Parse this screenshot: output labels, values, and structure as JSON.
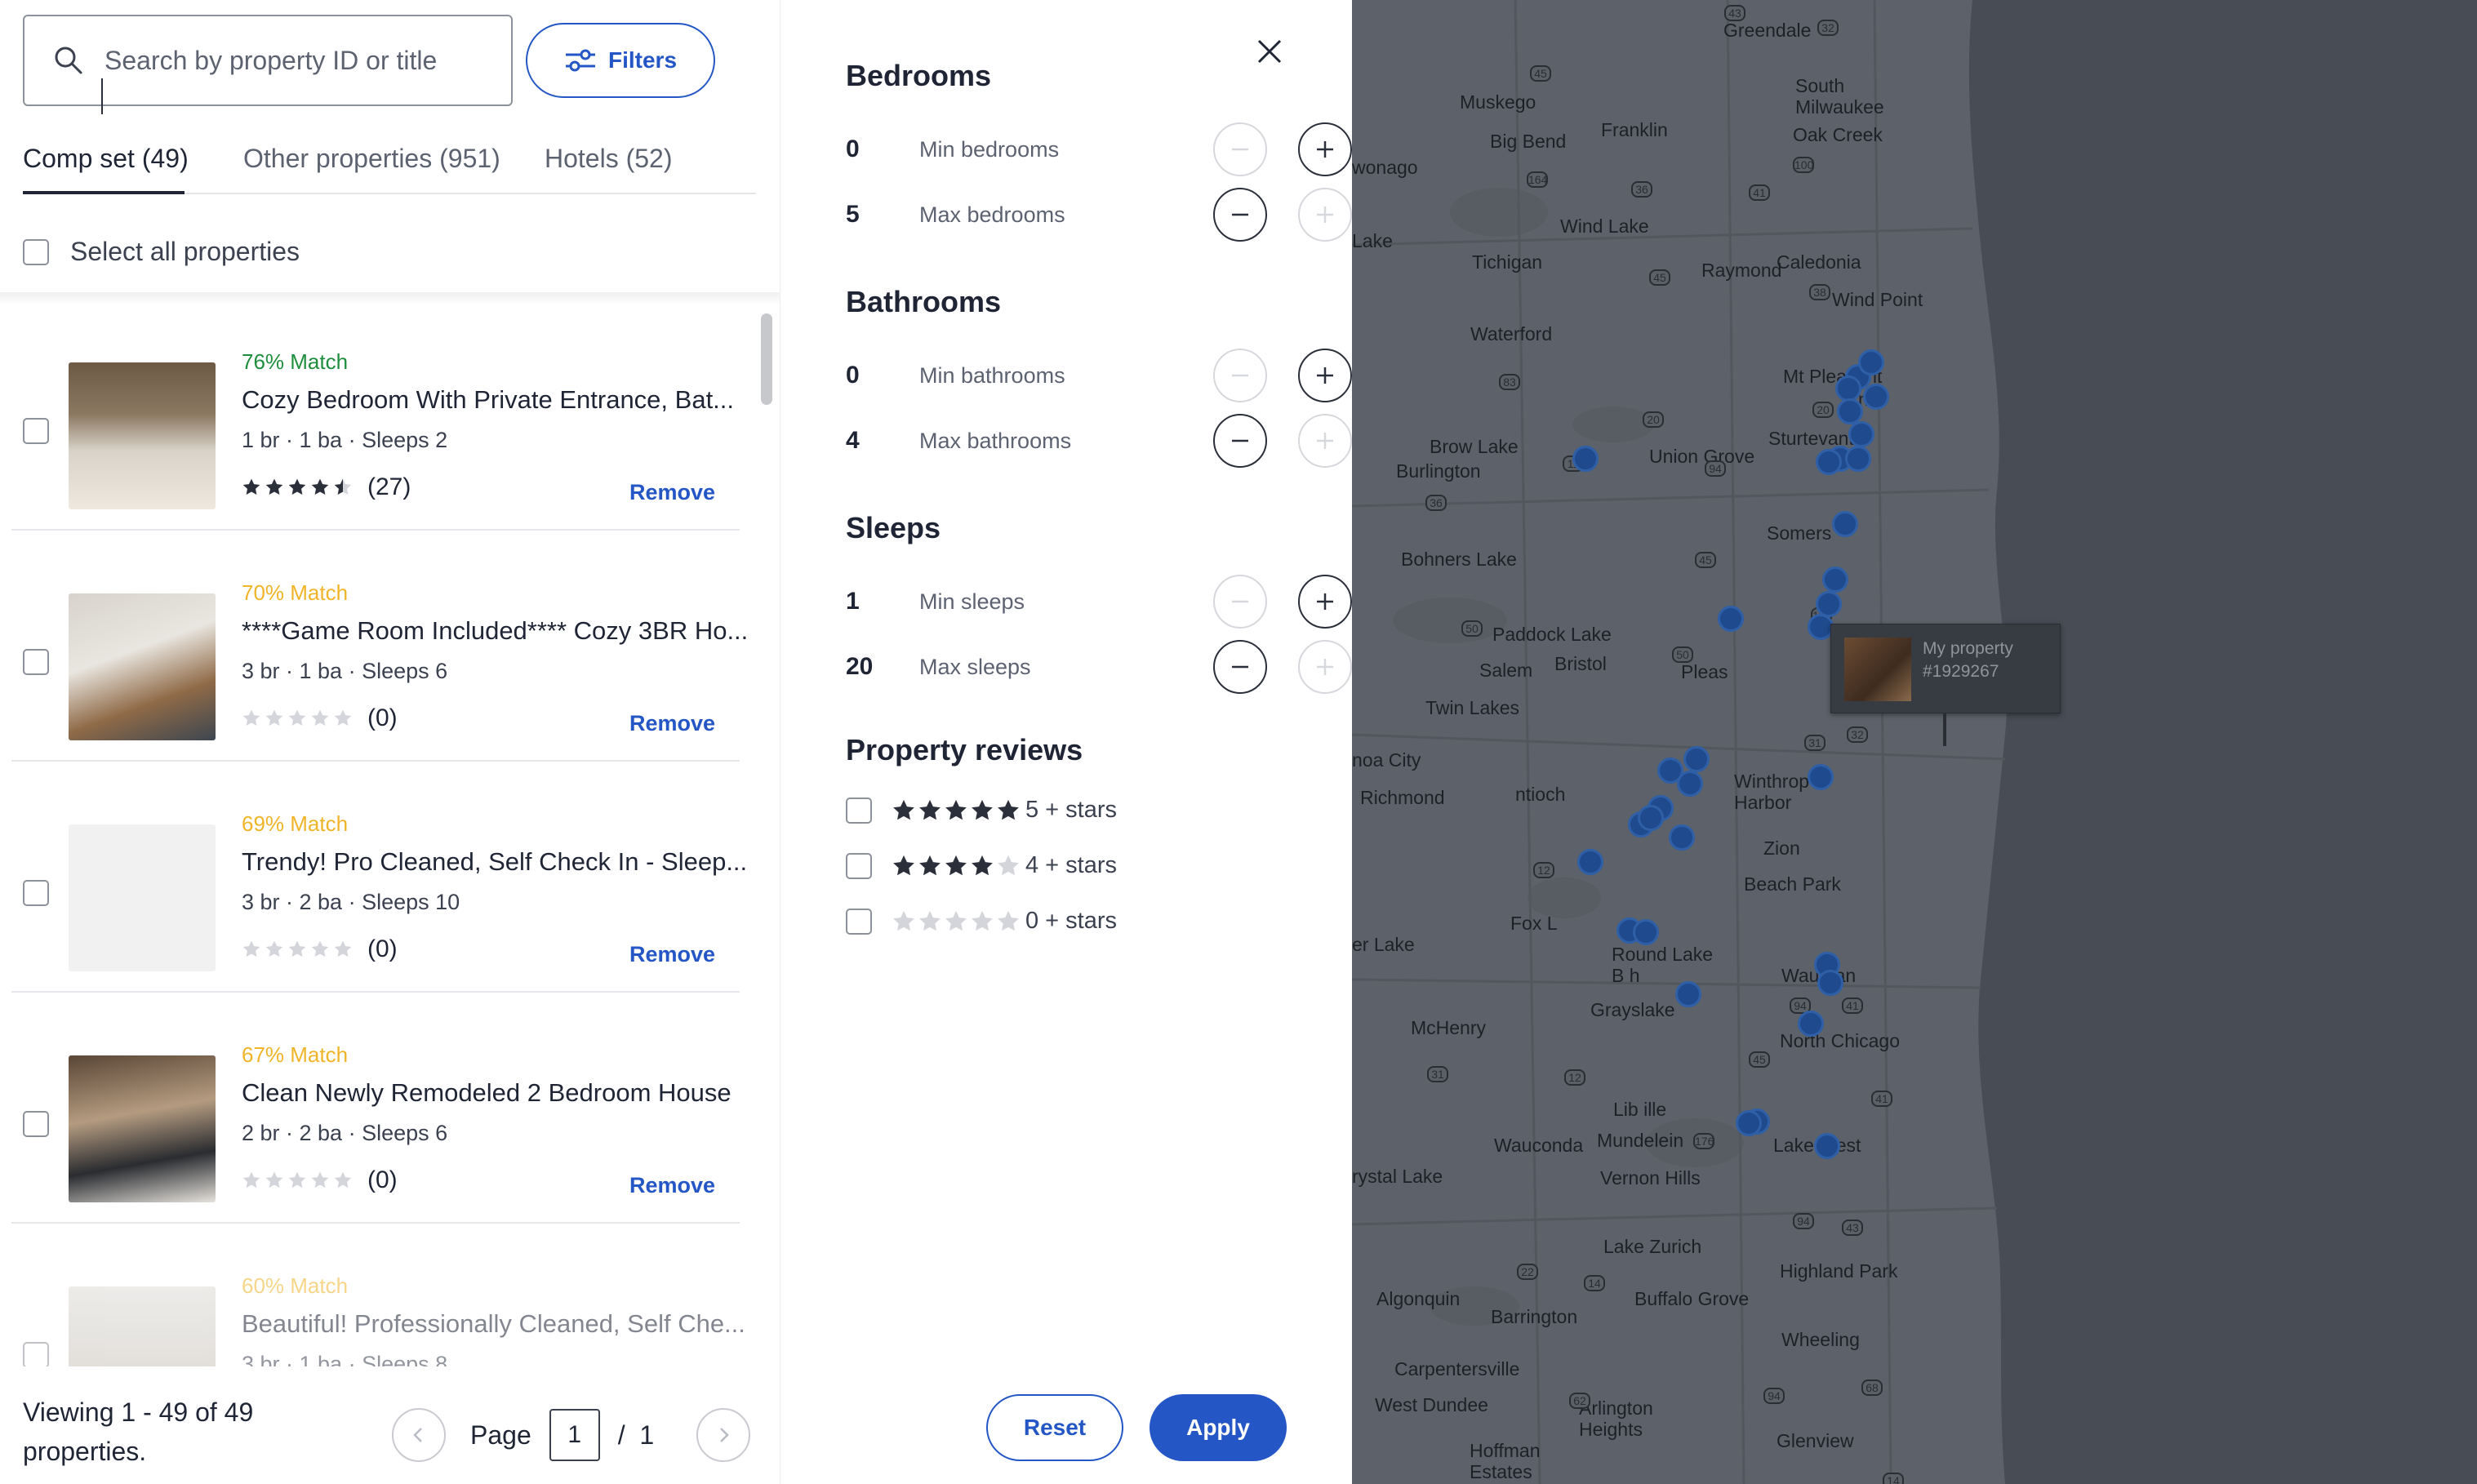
{
  "search": {
    "placeholder": "Search by property ID or title",
    "value": ""
  },
  "filters_button": {
    "label": "Filters"
  },
  "tabs": [
    {
      "label": "Comp set (49)",
      "active": true
    },
    {
      "label": "Other properties (951)",
      "active": false
    },
    {
      "label": "Hotels (52)",
      "active": false
    }
  ],
  "select_all": {
    "label": "Select all properties",
    "checked": false
  },
  "properties": [
    {
      "match": "76% Match",
      "match_color": "#1e8d3d",
      "title": "Cozy Bedroom With Private Entrance, Bat...",
      "meta": "1 br · 1 ba · Sleeps 2",
      "rating": 4.5,
      "reviews": "(27)",
      "remove": "Remove",
      "faded": false,
      "photo": "bedroom"
    },
    {
      "match": "70% Match",
      "match_color": "#f0b429",
      "title": "****Game Room Included**** Cozy 3BR Ho...",
      "meta": "3 br · 1 ba · Sleeps 6",
      "rating": 0,
      "reviews": "(0)",
      "remove": "Remove",
      "faded": false,
      "photo": "living"
    },
    {
      "match": "69% Match",
      "match_color": "#f0b429",
      "title": "Trendy! Pro Cleaned, Self Check In - Sleep...",
      "meta": "3 br · 2 ba · Sleeps 10",
      "rating": 0,
      "reviews": "(0)",
      "remove": "Remove",
      "faded": false,
      "photo": "none"
    },
    {
      "match": "67% Match",
      "match_color": "#f0b429",
      "title": "Clean Newly Remodeled 2 Bedroom House",
      "meta": "2 br · 2 ba · Sleeps 6",
      "rating": 0,
      "reviews": "(0)",
      "remove": "Remove",
      "faded": false,
      "photo": "lounge"
    },
    {
      "match": "60% Match",
      "match_color": "#f0b429",
      "title": "Beautiful! Professionally Cleaned, Self Che...",
      "meta": "3 br · 1 ba · Sleeps 8",
      "rating": 0,
      "reviews": "",
      "remove": "",
      "faded": true,
      "photo": "tv"
    }
  ],
  "footer": {
    "viewing": "Viewing 1 - 49 of 49 properties.",
    "page_label": "Page",
    "page_value": "1",
    "page_total": "/  1"
  },
  "filter_panel": {
    "sections": [
      {
        "title": "Bedrooms",
        "rows": [
          {
            "value": "0",
            "label": "Min bedrooms",
            "minus_enabled": false,
            "plus_enabled": true
          },
          {
            "value": "5",
            "label": "Max bedrooms",
            "minus_enabled": true,
            "plus_enabled": false
          }
        ]
      },
      {
        "title": "Bathrooms",
        "rows": [
          {
            "value": "0",
            "label": "Min bathrooms",
            "minus_enabled": false,
            "plus_enabled": true
          },
          {
            "value": "4",
            "label": "Max bathrooms",
            "minus_enabled": true,
            "plus_enabled": false
          }
        ]
      },
      {
        "title": "Sleeps",
        "rows": [
          {
            "value": "1",
            "label": "Min sleeps",
            "minus_enabled": false,
            "plus_enabled": true
          },
          {
            "value": "20",
            "label": "Max sleeps",
            "minus_enabled": true,
            "plus_enabled": false
          }
        ]
      }
    ],
    "reviews_title": "Property reviews",
    "review_options": [
      {
        "stars": 5,
        "label": "5 + stars",
        "checked": false
      },
      {
        "stars": 4,
        "label": "4 + stars",
        "checked": false
      },
      {
        "stars": 0,
        "label": "0 + stars",
        "checked": false
      }
    ],
    "reset_label": "Reset",
    "apply_label": "Apply"
  },
  "map": {
    "places": [
      "Greendale",
      "Muskego",
      "Franklin",
      "South Milwaukee",
      "Oak Creek",
      "Big Bend",
      "wonago",
      "Wind Lake",
      "Tichigan",
      "Raymond",
      "Caledonia",
      "Lake",
      "Wind Point",
      "Waterford",
      "Mt Pleasant",
      "Sturtevant",
      "Brow Lake",
      "Burlington",
      "Union Grove",
      "Somers",
      "Bohners Lake",
      "Paddock Lake",
      "Salem",
      "Bristol",
      "Pleas",
      "Twin Lakes",
      "Winthrop Harbor",
      "noa City",
      "Richmond",
      "ntioch",
      "Zion",
      "Beach Park",
      "Fox L",
      "er Lake",
      "Round Lake B h",
      "Wau gan",
      "Grayslake",
      "McHenry",
      "North Chicago",
      "Lib ille",
      "Wauconda",
      "Mundelein",
      "Lake orest",
      "rystal Lake",
      "Vernon Hills",
      "Lake Zurich",
      "Highland Park",
      "Algonquin",
      "Barrington",
      "Buffalo Grove",
      "Wheeling",
      "Carpentersville",
      "West Dundee",
      "Arlington Heights",
      "Glenview",
      "Hoffman Estates",
      "ne"
    ],
    "route_numbers": [
      "43",
      "32",
      "45",
      "100",
      "164",
      "36",
      "41",
      "45",
      "38",
      "20",
      "83",
      "11",
      "20",
      "94",
      "36",
      "45",
      "50",
      "50",
      "158",
      "31",
      "32",
      "12",
      "94",
      "41",
      "45",
      "31",
      "12",
      "176",
      "41",
      "43",
      "94",
      "22",
      "14",
      "62",
      "94",
      "68",
      "14"
    ],
    "tooltip": {
      "line1": "My property",
      "line2": "#1929267"
    },
    "pin_color": "#1f4a8d"
  }
}
